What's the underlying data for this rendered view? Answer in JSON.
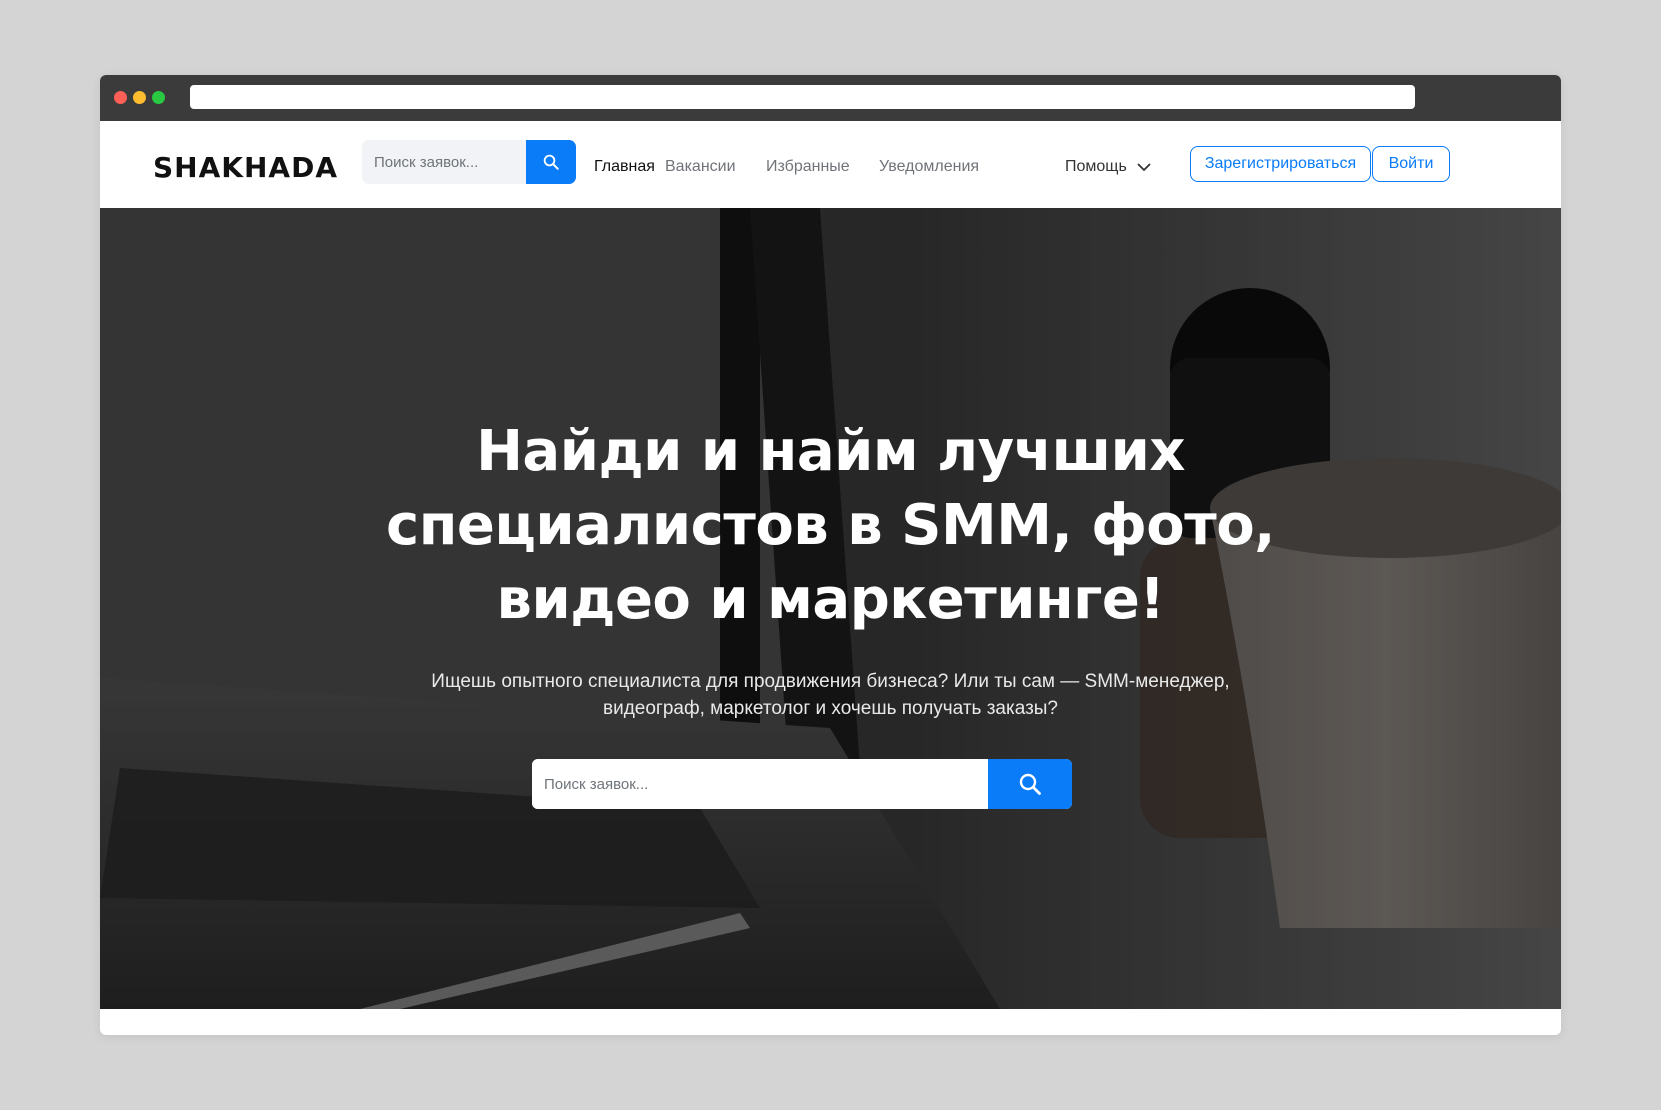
{
  "brand": {
    "logo": "SHAKHADA"
  },
  "nav": {
    "search_placeholder": "Поиск заявок...",
    "links": [
      {
        "label": "Главная",
        "active": true
      },
      {
        "label": "Вакансии"
      },
      {
        "label": "Избранные"
      },
      {
        "label": "Уведомления"
      }
    ],
    "help_label": "Помощь",
    "register_label": "Зарегистрироваться",
    "login_label": "Войти"
  },
  "hero": {
    "title_lines": [
      "Найди и найм лучших",
      "специалистов в SMM, фото,",
      "видео и маркетинге!"
    ],
    "subtitle_lines": [
      "Ищешь опытного специалиста для продвижения бизнеса? Или ты сам — SMM-менеджер,",
      "видеограф, маркетолог и хочешь получать заказы?"
    ],
    "search_placeholder": "Поиск заявок..."
  },
  "icons": {
    "search": "search-icon",
    "chevron": "chevron-down-icon"
  },
  "colors": {
    "accent": "#0a7cf7",
    "chrome": "#3b3b3b",
    "page_background": "#d4d4d4"
  }
}
